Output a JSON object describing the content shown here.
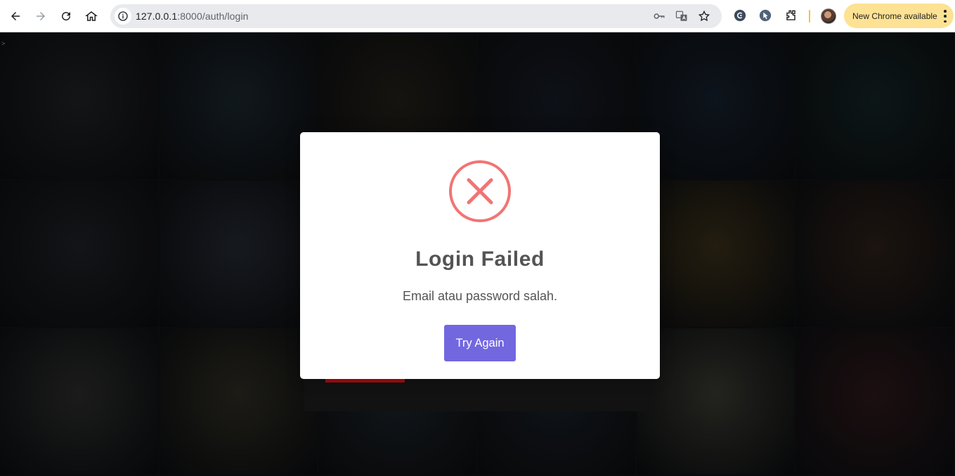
{
  "browser": {
    "url_host": "127.0.0.1",
    "url_path": ":8000/auth/login",
    "update_label": "New Chrome available",
    "accent_update": "#fde293"
  },
  "page": {
    "corner_mark": ">",
    "background_tiles": [
      {
        "color": "#2a2c30"
      },
      {
        "color": "#24323c"
      },
      {
        "color": "#2e2a22"
      },
      {
        "color": "#1e2430"
      },
      {
        "color": "#1c2a3a"
      },
      {
        "color": "#1a2f30"
      },
      {
        "color": "#282b31"
      },
      {
        "color": "#2f3540"
      },
      {
        "color": "#223a48"
      },
      {
        "color": "#1e2a36"
      },
      {
        "color": "#4a3d22"
      },
      {
        "color": "#3a2a22"
      },
      {
        "color": "#3a3a3a"
      },
      {
        "color": "#3c3a2e"
      },
      {
        "color": "#263038"
      },
      {
        "color": "#222a33"
      },
      {
        "color": "#4a4a40"
      },
      {
        "color": "#3a2024"
      }
    ]
  },
  "modal": {
    "icon": "error-x-icon",
    "icon_color": "#f27474",
    "title": "Login Failed",
    "message": "Email atau password salah.",
    "button_label": "Try Again",
    "button_color": "#7367e0"
  }
}
